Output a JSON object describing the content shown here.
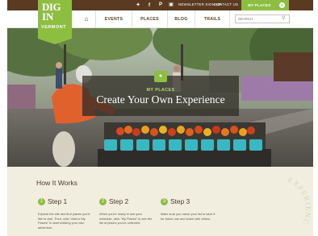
{
  "top_bar": {
    "newsletter": "NEWSLETTER SIGN-UP",
    "contact": "CONTACT US",
    "my_places": "MY PLACES",
    "my_places_count": "0",
    "social_icons": [
      "twitter-icon",
      "facebook-icon",
      "pinterest-icon",
      "instagram-icon"
    ]
  },
  "logo": {
    "line1": "DIG",
    "line2": "IN",
    "line3": "VERMONT"
  },
  "nav": {
    "items": [
      "EVENTS",
      "PLACES",
      "BLOG",
      "TRAILS"
    ],
    "search_placeholder": "SEARCH"
  },
  "hero": {
    "kicker": "MY PLACES",
    "title": "Create Your Own Experience"
  },
  "how": {
    "title": "How It Works",
    "steps": [
      {
        "num": "1",
        "title": "Step 1",
        "text": "Explore the site and find places you'd like to visit. Then, click \"Add to My Places\" to start building your own adventure."
      },
      {
        "num": "2",
        "title": "Step 2",
        "text": "When you're ready to see your schedule, click \"My Places\" to see the list of places you've collected."
      },
      {
        "num": "3",
        "title": "Step 3",
        "text": "Make sure you name your list to save it for future use and share with others."
      }
    ],
    "stamp_text": "EXPERIENC"
  },
  "colors": {
    "brand_green": "#8cbe3f",
    "top_bar_brown": "#5a3b22",
    "section_bg": "#f1eee0"
  }
}
